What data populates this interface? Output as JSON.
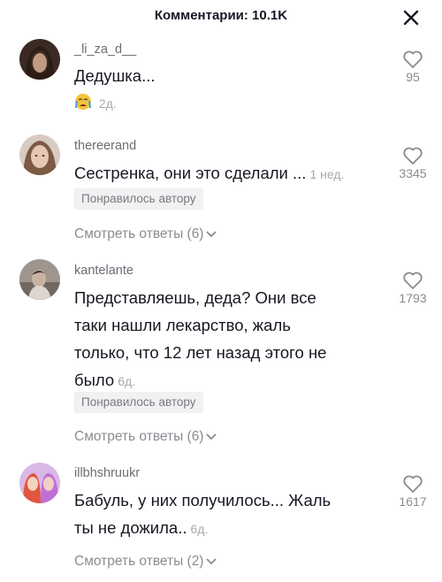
{
  "header": {
    "title": "Комментарии: 10.1K"
  },
  "comments": [
    {
      "username": "_li_za_d__",
      "text": "Дедушка...",
      "time": "2д.",
      "likes": "95"
    },
    {
      "username": "thereerand",
      "text": "Сестренка, они это сделали ...",
      "time": "1 нед.",
      "likes": "3345",
      "badge": "Понравилось автору",
      "replies": "Смотреть ответы (6)"
    },
    {
      "username": "kantelante",
      "text_lines": [
        "Представляешь, деда? Они все",
        "таки нашли лекарство, жаль",
        "только, что 12 лет назад этого не",
        "было"
      ],
      "time": "6д.",
      "likes": "1793",
      "badge": "Понравилось автору",
      "replies": "Смотреть ответы (6)"
    },
    {
      "username": "illbhshruukr",
      "text_lines": [
        "Бабуль, у них получилось... Жаль",
        "ты не дожила.."
      ],
      "time": "6д.",
      "likes": "1617",
      "replies": "Смотреть ответы (2)"
    }
  ],
  "colors": {
    "text": "#161823",
    "muted": "#8a8b91",
    "badge_bg": "#f1f1f2"
  },
  "icons": {
    "close": "close-icon",
    "like": "heart-outline-icon",
    "expand": "chevron-down-icon",
    "reaction": "crying-face-emoji"
  }
}
